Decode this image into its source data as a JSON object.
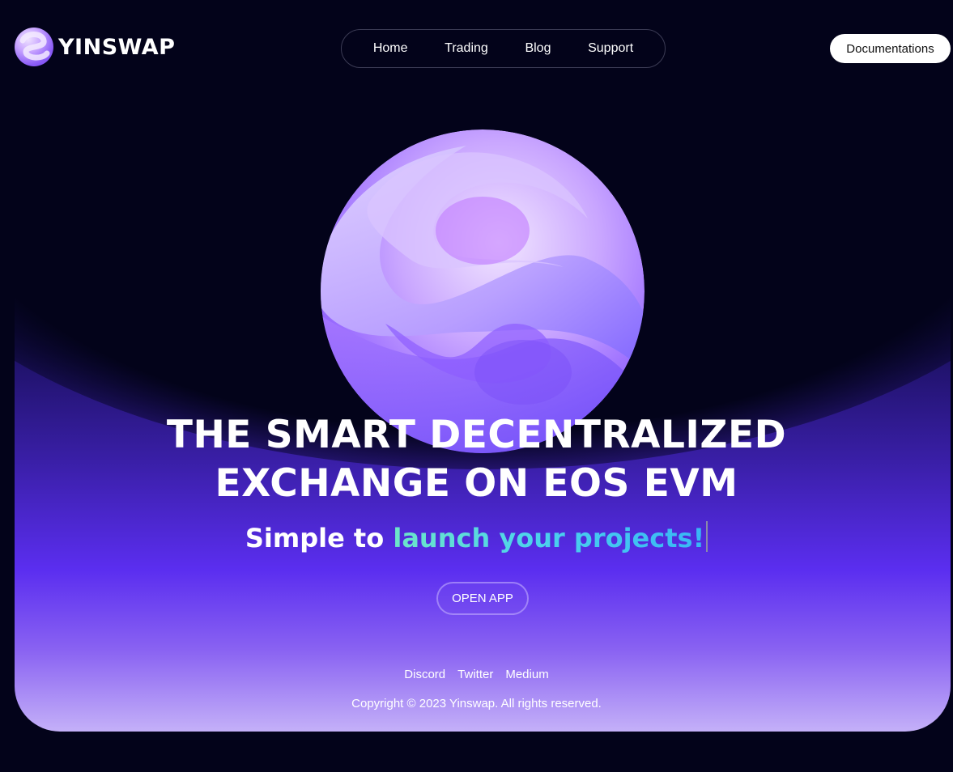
{
  "header": {
    "logo_text": "YINSWAP",
    "nav": [
      "Home",
      "Trading",
      "Blog",
      "Support"
    ],
    "docs_label": "Documentations"
  },
  "hero": {
    "headline_line1": "THE SMART DECENTRALIZED",
    "headline_line2": "EXCHANGE ON EOS EVM",
    "sub_plain": "Simple to",
    "sub_highlight": "launch your projects!",
    "cta_label": "OPEN APP"
  },
  "footer": {
    "socials": [
      "Discord",
      "Twitter",
      "Medium"
    ],
    "copyright": "Copyright © 2023 Yinswap. All rights reserved."
  },
  "colors": {
    "background": "#03031a",
    "accent": "#5b2ef0",
    "highlight_start": "#6de6c8",
    "highlight_end": "#38b6f6"
  }
}
